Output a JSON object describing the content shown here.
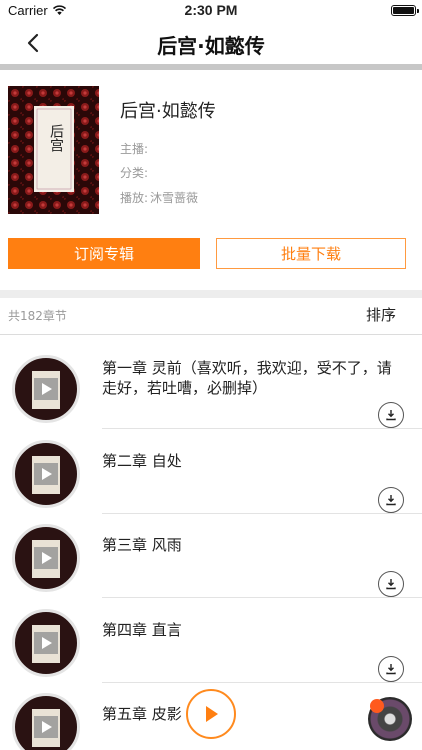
{
  "status_bar": {
    "carrier": "Carrier",
    "time": "2:30 PM"
  },
  "nav": {
    "title": "后宫·如懿传"
  },
  "album": {
    "title": "后宫·如懿传",
    "host_label": "主播:",
    "host_value": "",
    "category_label": "分类:",
    "category_value": "",
    "play_label": "播放:",
    "play_value": "沐雪蔷薇",
    "cover_text": "后宫"
  },
  "buttons": {
    "subscribe": "订阅专辑",
    "download": "批量下载"
  },
  "list_header": {
    "count": "共182章节",
    "sort": "排序"
  },
  "episodes": [
    {
      "title": "第一章 灵前（喜欢听，我欢迎，受不了，请走好，若吐嘈，必删掉）"
    },
    {
      "title": "第二章 自处"
    },
    {
      "title": "第三章 风雨"
    },
    {
      "title": "第四章 直言"
    },
    {
      "title": "第五章 皮影"
    }
  ],
  "colors": {
    "accent": "#ff7f11",
    "divider": "#c7c7c7"
  },
  "icons": {
    "back": "chevron-left-icon",
    "download": "download-icon",
    "play": "play-icon",
    "wifi": "wifi-icon",
    "battery": "battery-icon"
  }
}
